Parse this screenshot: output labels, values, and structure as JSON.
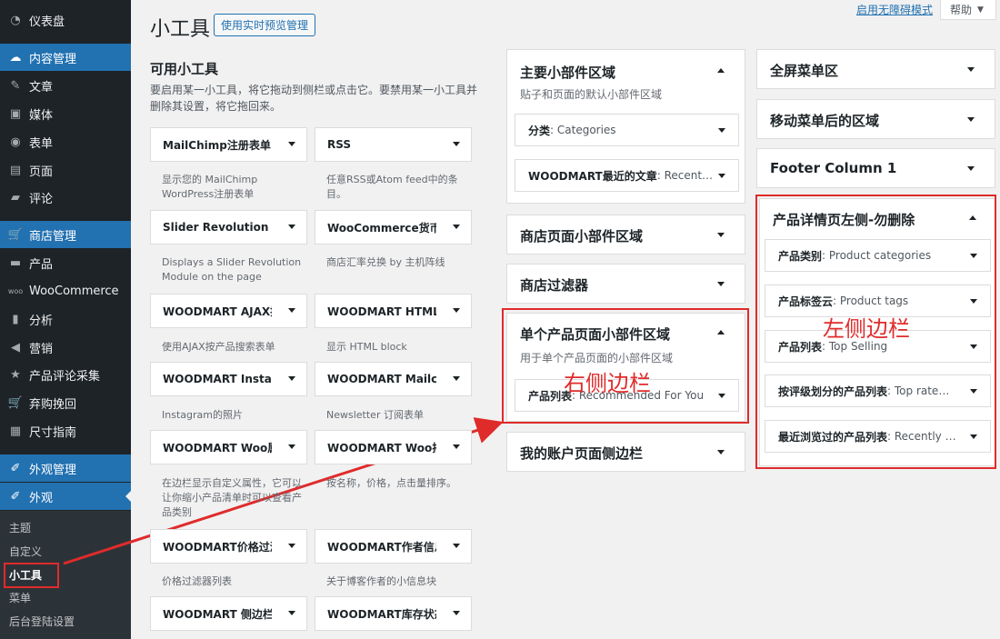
{
  "sidebar": {
    "items": [
      {
        "label": "仪表盘",
        "icon": "dashboard-icon"
      },
      {
        "label": "内容管理",
        "icon": "cloud-icon"
      },
      {
        "label": "文章",
        "icon": "pin-icon"
      },
      {
        "label": "媒体",
        "icon": "media-icon"
      },
      {
        "label": "表单",
        "icon": "form-icon"
      },
      {
        "label": "页面",
        "icon": "page-icon"
      },
      {
        "label": "评论",
        "icon": "comment-icon"
      },
      {
        "label": "商店管理",
        "icon": "cart-icon"
      },
      {
        "label": "产品",
        "icon": "archive-icon"
      },
      {
        "label": "WooCommerce",
        "icon": "woo-icon"
      },
      {
        "label": "分析",
        "icon": "bar-chart-icon"
      },
      {
        "label": "营销",
        "icon": "megaphone-icon"
      },
      {
        "label": "产品评论采集",
        "icon": "star-icon"
      },
      {
        "label": "弃购挽回",
        "icon": "cart-icon"
      },
      {
        "label": "尺寸指南",
        "icon": "ruler-icon"
      },
      {
        "label": "外观管理",
        "icon": "brush-icon"
      },
      {
        "label": "外观",
        "icon": "brush-icon"
      }
    ],
    "submenu": [
      "主题",
      "自定义",
      "小工具",
      "菜单",
      "后台登陆设置"
    ]
  },
  "header": {
    "title": "小工具",
    "preview_button": "使用实时预览管理",
    "a11y_link": "启用无障碍模式",
    "help": "帮助"
  },
  "available": {
    "title": "可用小工具",
    "desc": "要启用某一小工具，将它拖动到侧栏或点击它。要禁用某一小工具并删除其设置，将它拖回来。",
    "widgets": [
      {
        "name": "MailChimp注册表单",
        "desc": "显示您的 MailChimp WordPress注册表单"
      },
      {
        "name": "RSS",
        "desc": "任意RSS或Atom feed中的条目。"
      },
      {
        "name": "Slider Revolution",
        "desc": "Displays a Slider Revolution Module on the page"
      },
      {
        "name": "WooCommerce货币转换",
        "desc": "商店汇率兑换 by 主机阵线"
      },
      {
        "name": "WOODMART AJAX搜索",
        "desc": "使用AJAX按产品搜索表单"
      },
      {
        "name": "WOODMART HTML块",
        "desc": "显示 HTML block"
      },
      {
        "name": "WOODMART Instagram",
        "desc": "Instagram的照片"
      },
      {
        "name": "WOODMART Mailchimp",
        "desc": "Newsletter 订阅表单"
      },
      {
        "name": "WOODMART Woo属性过滤",
        "desc": "在边栏显示自定义属性，它可以让你缩小产品清单时可以查看产品类别"
      },
      {
        "name": "WOODMART Woo排序",
        "desc": "按名称，价格，点击量排序。"
      },
      {
        "name": "WOODMART价格过滤",
        "desc": "价格过滤器列表"
      },
      {
        "name": "WOODMART作者信息",
        "desc": "关于博客作者的小信息块"
      },
      {
        "name": "WOODMART 侧边栏菜单",
        "desc": ""
      },
      {
        "name": "WOODMART库存状态",
        "desc": ""
      }
    ]
  },
  "areas_col1": {
    "main": {
      "title": "主要小部件区域",
      "desc": "贴子和页面的默认小部件区域",
      "widgets": [
        {
          "type": "分类",
          "title": "Categories"
        },
        {
          "type": "WOODMART最近的文章",
          "title": "Recent Posts"
        }
      ]
    },
    "shop": {
      "title": "商店页面小部件区域"
    },
    "filters": {
      "title": "商店过滤器"
    },
    "single": {
      "title": "单个产品页面小部件区域",
      "desc": "用于单个产品页面的小部件区域",
      "widgets": [
        {
          "type": "产品列表",
          "title": "Recommended For You"
        }
      ]
    },
    "account": {
      "title": "我的账户页面侧边栏"
    }
  },
  "areas_col2": {
    "fullscreen": {
      "title": "全屏菜单区"
    },
    "after_mobile": {
      "title": "移动菜单后的区域"
    },
    "footer1": {
      "title": "Footer Column 1"
    },
    "product_left": {
      "title": "产品详情页左侧-勿删除",
      "widgets": [
        {
          "type": "产品类别",
          "title": "Product categories"
        },
        {
          "type": "产品标签云",
          "title": "Product tags"
        },
        {
          "type": "产品列表",
          "title": "Top Selling"
        },
        {
          "type": "按评级划分的产品列表",
          "title": "Top rated products"
        },
        {
          "type": "最近浏览过的产品列表",
          "title": "Recently Viewed"
        }
      ]
    }
  },
  "annotations": {
    "right_sidebar": "右侧边栏",
    "left_sidebar": "左侧边栏"
  },
  "colors": {
    "accent": "#2271b1",
    "annotation": "#e02b2b",
    "sidebar_bg": "#1d2327"
  }
}
